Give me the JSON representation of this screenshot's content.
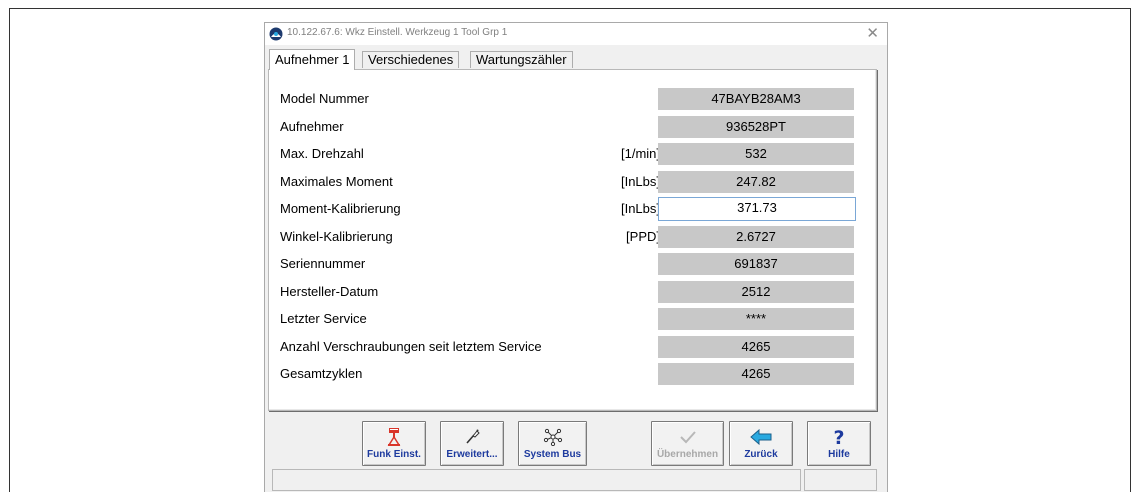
{
  "window": {
    "title": "10.122.67.6: Wkz Einstell. Werkzeug 1  Tool Grp 1",
    "close_symbol": "✕"
  },
  "tabs": [
    {
      "label": "Aufnehmer 1",
      "active": true
    },
    {
      "label": "Verschiedenes",
      "active": false
    },
    {
      "label": "Wartungszähler",
      "active": false
    }
  ],
  "rows": [
    {
      "label": "Model Nummer",
      "unit": "",
      "value": "47BAYB28AM3"
    },
    {
      "label": "Aufnehmer",
      "unit": "",
      "value": "936528PT"
    },
    {
      "label": "Max. Drehzahl",
      "unit": "[1/min]",
      "value": "532"
    },
    {
      "label": "Maximales Moment",
      "unit": "[InLbs]",
      "value": "247.82"
    },
    {
      "label": "Moment-Kalibrierung",
      "unit": "[InLbs]",
      "value": "371.73"
    },
    {
      "label": "Winkel-Kalibrierung",
      "unit": "[PPD]",
      "value": "2.6727"
    },
    {
      "label": "Seriennummer",
      "unit": "",
      "value": "691837"
    },
    {
      "label": "Hersteller-Datum",
      "unit": "",
      "value": "2512"
    },
    {
      "label": "Letzter Service",
      "unit": "",
      "value": "****"
    },
    {
      "label": "Anzahl Verschraubungen seit letztem Service",
      "unit": "",
      "value": "4265"
    },
    {
      "label": "Gesamtzyklen",
      "unit": "",
      "value": "4265"
    }
  ],
  "buttons": {
    "funk": {
      "label": "Funk Einst.",
      "icon": "radio-transmitter-icon"
    },
    "erweitert": {
      "label": "Erweitert...",
      "icon": "screwdriver-icon"
    },
    "systembus": {
      "label": "System Bus",
      "icon": "network-nodes-icon"
    },
    "uebernehmen": {
      "label": "Übernehmen",
      "icon": "checkmark-icon",
      "disabled": true
    },
    "zurueck": {
      "label": "Zurück",
      "icon": "arrow-left-icon"
    },
    "hilfe": {
      "label": "Hilfe",
      "icon": "question-mark-icon"
    }
  },
  "colors": {
    "button_label": "#1d3a9e",
    "value_bg": "#c8c8c8",
    "arrow": "#29a9e0",
    "help": "#1d3a9e"
  }
}
